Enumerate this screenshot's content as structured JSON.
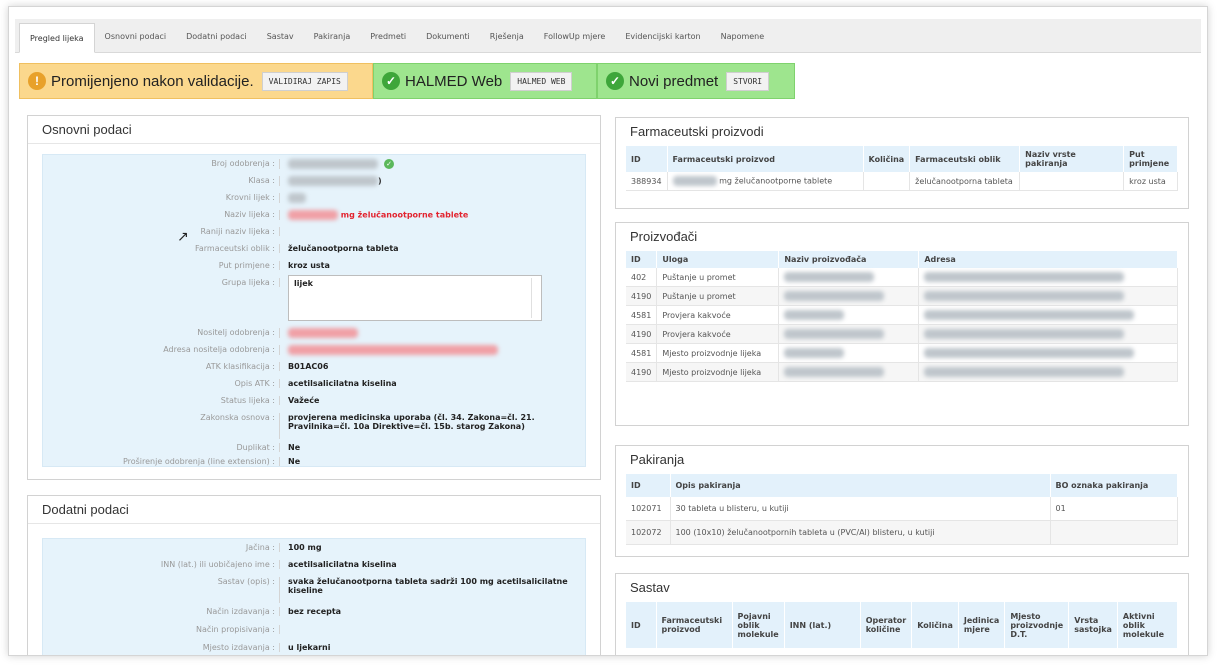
{
  "tabs": [
    {
      "label": "Pregled lijeka",
      "active": true
    },
    {
      "label": "Osnovni podaci",
      "active": false
    },
    {
      "label": "Dodatni podaci",
      "active": false
    },
    {
      "label": "Sastav",
      "active": false
    },
    {
      "label": "Pakiranja",
      "active": false
    },
    {
      "label": "Predmeti",
      "active": false
    },
    {
      "label": "Dokumenti",
      "active": false
    },
    {
      "label": "Rješenja",
      "active": false
    },
    {
      "label": "FollowUp mjere",
      "active": false
    },
    {
      "label": "Evidencijski karton",
      "active": false
    },
    {
      "label": "Napomene",
      "active": false
    }
  ],
  "banners": {
    "warning": {
      "text": "Promijenjeno nakon validacije.",
      "button": "VALIDIRAJ ZAPIS",
      "icon": "exclamation-icon",
      "color": "#fbd88d"
    },
    "halmed": {
      "text": "HALMED Web",
      "button": "HALMED WEB",
      "icon": "check-circle-icon",
      "color": "#9ee58e"
    },
    "predmet": {
      "text": "Novi predmet",
      "button": "STVORI",
      "icon": "check-circle-icon",
      "color": "#9ee58e"
    }
  },
  "osnovni": {
    "title": "Osnovni podaci",
    "labels": {
      "broj": "Broj odobrenja :",
      "klasa": "Klasa :",
      "krovni": "Krovni lijek :",
      "naziv": "Naziv lijeka :",
      "raniji": "Raniji naziv lijeka :",
      "oblik": "Farmaceutski oblik :",
      "put": "Put primjene :",
      "grupa": "Grupa lijeka :",
      "nositelj": "Nositelj odobrenja :",
      "adresa": "Adresa nositelja odobrenja :",
      "atk": "ATK klasifikacija :",
      "opis_atk": "Opis ATK :",
      "status": "Status lijeka :",
      "zakonska": "Zakonska osnova :",
      "duplikat": "Duplikat :",
      "prosirenje": "Proširenje odobrenja (line extension) :"
    },
    "values": {
      "klasa_suffix": ")",
      "naziv_suffix": "mg želučanootporne tablete",
      "oblik": "želučanootporna tableta",
      "put": "kroz usta",
      "grupa": "lijek",
      "atk": "B01AC06",
      "opis_atk": "acetilsalicilatna kiselina",
      "status": "Važeće",
      "zakonska_1": "provjerena medicinska uporaba (čl. 34. Zakona=čl. 21.",
      "zakonska_2": "Pravilnika=čl. 10a Direktive=čl. 15b. starog Zakona)",
      "duplikat": "Ne",
      "prosirenje": "Ne"
    }
  },
  "dodatni": {
    "title": "Dodatni podaci",
    "labels": {
      "jacina": "Jačina :",
      "inn": "INN (lat.) ili uobičajeno ime :",
      "sastav": "Sastav (opis) :",
      "nacin_izdavanja": "Način izdavanja :",
      "nacin_propisivanja": "Način propisivanja :",
      "mjesto": "Mjesto izdavanja :"
    },
    "values": {
      "jacina": "100 mg",
      "inn": "acetilsalicilatna kiselina",
      "sastav_1": "svaka želučanootporna tableta sadrži 100 mg acetilsalicilatne",
      "sastav_2": "kiseline",
      "nacin_izdavanja": "bez recepta",
      "mjesto": "u ljekarni"
    }
  },
  "farm": {
    "title": "Farmaceutski proizvodi",
    "headers": [
      "ID",
      "Farmaceutski proizvod",
      "Količina",
      "Farmaceutski oblik",
      "Naziv vrste pakiranja",
      "Put primjene"
    ],
    "row": {
      "id": "388934",
      "proizvod": "mg želučanootporne tablete",
      "oblik": "želučanootporna tableta",
      "put": "kroz usta"
    }
  },
  "proiz": {
    "title": "Proizvođači",
    "headers": [
      "ID",
      "Uloga",
      "Naziv proizvođača",
      "Adresa"
    ],
    "rows": [
      {
        "id": "402",
        "uloga": "Puštanje u promet"
      },
      {
        "id": "4190",
        "uloga": "Puštanje u promet"
      },
      {
        "id": "4581",
        "uloga": "Provjera kakvoće"
      },
      {
        "id": "4190",
        "uloga": "Provjera kakvoće"
      },
      {
        "id": "4581",
        "uloga": "Mjesto proizvodnje lijeka"
      },
      {
        "id": "4190",
        "uloga": "Mjesto proizvodnje lijeka"
      }
    ]
  },
  "pak": {
    "title": "Pakiranja",
    "headers": [
      "ID",
      "Opis pakiranja",
      "BO oznaka pakiranja"
    ],
    "rows": [
      {
        "id": "102071",
        "opis": "30 tableta u blisteru, u kutiji",
        "bo": "01"
      },
      {
        "id": "102072",
        "opis": "100 (10x10) želučanootpornih tableta u (PVC/Al) blisteru, u kutiji",
        "bo": ""
      }
    ]
  },
  "sastav": {
    "title": "Sastav",
    "headers": [
      "ID",
      "Farmaceutski proizvod",
      "Pojavni oblik molekule",
      "INN (lat.)",
      "Operator količine",
      "Količina",
      "Jedinica mjere",
      "Mjesto proizvodnje D.T.",
      "Vrsta sastojka",
      "Aktivni oblik molekule"
    ]
  }
}
